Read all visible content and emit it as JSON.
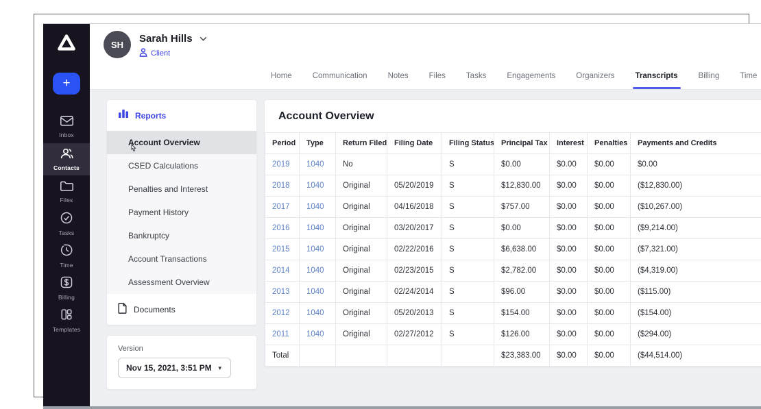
{
  "colors": {
    "sidebar_bg": "#17131f",
    "accent_blue": "#4046e3",
    "plus_button_blue": "#2b52f5",
    "active_tab_underline": "#4f5ae8",
    "table_link_blue": "#5b80c7"
  },
  "sidebar": {
    "plus_label": "+",
    "items": [
      {
        "label": "Inbox"
      },
      {
        "label": "Contacts"
      },
      {
        "label": "Files"
      },
      {
        "label": "Tasks"
      },
      {
        "label": "Time"
      },
      {
        "label": "Billing"
      },
      {
        "label": "Templates"
      }
    ]
  },
  "client": {
    "initials": "SH",
    "name": "Sarah Hills",
    "type_label": "Client"
  },
  "nav": {
    "tabs": [
      "Home",
      "Communication",
      "Notes",
      "Files",
      "Tasks",
      "Engagements",
      "Organizers",
      "Transcripts",
      "Billing",
      "Time"
    ],
    "active_tab": "Transcripts"
  },
  "reports_panel": {
    "title": "Reports",
    "items": [
      "Account Overview",
      "CSED Calculations",
      "Penalties and Interest",
      "Payment History",
      "Bankruptcy",
      "Account Transactions",
      "Assessment Overview"
    ],
    "active_item": "Account Overview",
    "documents_label": "Documents"
  },
  "version": {
    "label": "Version",
    "value": "Nov 15, 2021, 3:51 PM"
  },
  "table": {
    "title": "Account Overview",
    "headers": [
      "Period",
      "Type",
      "Return Filed",
      "Filing Date",
      "Filing Status",
      "Principal Tax",
      "Interest",
      "Penalties",
      "Payments and Credits"
    ],
    "rows": [
      [
        "2019",
        "1040",
        "No",
        "",
        "S",
        "$0.00",
        "$0.00",
        "$0.00",
        "$0.00"
      ],
      [
        "2018",
        "1040",
        "Original",
        "05/20/2019",
        "S",
        "$12,830.00",
        "$0.00",
        "$0.00",
        "($12,830.00)"
      ],
      [
        "2017",
        "1040",
        "Original",
        "04/16/2018",
        "S",
        "$757.00",
        "$0.00",
        "$0.00",
        "($10,267.00)"
      ],
      [
        "2016",
        "1040",
        "Original",
        "03/20/2017",
        "S",
        "$0.00",
        "$0.00",
        "$0.00",
        "($9,214.00)"
      ],
      [
        "2015",
        "1040",
        "Original",
        "02/22/2016",
        "S",
        "$6,638.00",
        "$0.00",
        "$0.00",
        "($7,321.00)"
      ],
      [
        "2014",
        "1040",
        "Original",
        "02/23/2015",
        "S",
        "$2,782.00",
        "$0.00",
        "$0.00",
        "($4,319.00)"
      ],
      [
        "2013",
        "1040",
        "Original",
        "02/24/2014",
        "S",
        "$96.00",
        "$0.00",
        "$0.00",
        "($115.00)"
      ],
      [
        "2012",
        "1040",
        "Original",
        "05/20/2013",
        "S",
        "$154.00",
        "$0.00",
        "$0.00",
        "($154.00)"
      ],
      [
        "2011",
        "1040",
        "Original",
        "02/27/2012",
        "S",
        "$126.00",
        "$0.00",
        "$0.00",
        "($294.00)"
      ]
    ],
    "total": {
      "label": "Total",
      "principal_tax": "$23,383.00",
      "interest": "$0.00",
      "penalties": "$0.00",
      "payments_credits": "($44,514.00)"
    }
  }
}
